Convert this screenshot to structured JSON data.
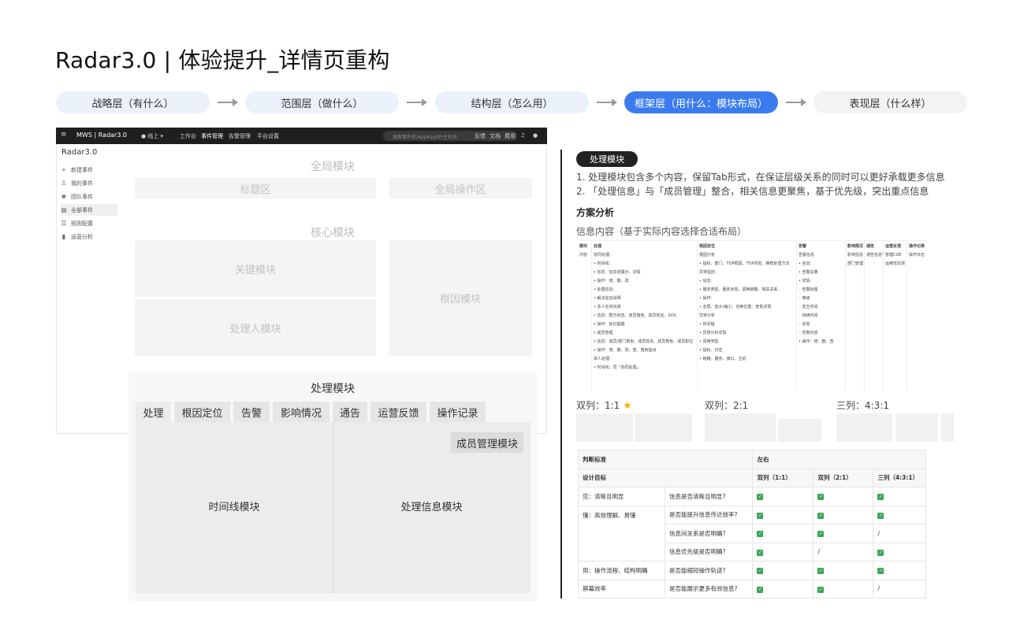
{
  "title": "Radar3.0 | 体验提升_详情页重构",
  "steps": [
    "战略层（有什么）",
    "范围层（做什么）",
    "结构层（怎么用）",
    "框架层（用什么：模块布局）",
    "表现层（什么样）"
  ],
  "appbar": {
    "logo": "MWS | Radar3.0",
    "env": "● 线上 ▾",
    "nav": [
      "工作台",
      "事件管理",
      "告警管理",
      "平台设置"
    ],
    "search_placeholder": "搜索事件名/AppKey/IP/主机名",
    "right": [
      "反馈",
      "文档",
      "费用"
    ]
  },
  "sidebar": {
    "title": "Radar3.0",
    "items": [
      {
        "icon": "+",
        "label": "新建事件"
      },
      {
        "icon": "♙",
        "label": "我的事件"
      },
      {
        "icon": "♚",
        "label": "团队事件"
      },
      {
        "icon": "▤",
        "label": "全部事件"
      },
      {
        "icon": "☰",
        "label": "规则配置"
      },
      {
        "icon": "▮",
        "label": "运营分析"
      }
    ]
  },
  "wire": {
    "global": "全局模块",
    "title_area": "标题区",
    "global_ops": "全局操作区",
    "core": "核心模块",
    "key": "关键模块",
    "handler": "处理人模块",
    "root": "根因模块",
    "process": "处理模块",
    "tabs": [
      "处理",
      "根因定位",
      "告警",
      "影响情况",
      "通告",
      "运营反馈",
      "操作记录"
    ],
    "member": "成员管理模块",
    "timeline": "时间线模块",
    "info": "处理信息模块"
  },
  "right": {
    "pill": "处理模块",
    "notes": [
      "1. 处理模块包含多个内容，保留Tab形式，在保证层级关系的同时可以更好承载更多信息",
      "2. 「处理信息」与「成员管理」整合，相关信息更聚焦，基于优先级，突出重点信息"
    ],
    "analysis": "方案分析",
    "info_content": "信息内容（基于实际内容选择合适布局）",
    "mini_table": {
      "headers": [
        "模块",
        "处理",
        "根因定位",
        "告警",
        "影响情况",
        "通告",
        "运营反馈",
        "操作记录"
      ],
      "col0": [
        "内容"
      ],
      "col1": [
        "协同处理：",
        "• 时间线：",
        "  • 信息：信息流展示、详情",
        "  • 操作：增、删、改",
        "• 处理信息：",
        "  • 解决信息说明",
        "  • 多人在线沟通",
        "    • 信息：群方状态、成员角色、成员姓名、SOS",
        "    • 操作：标记提醒",
        "  • 成员管理",
        "    • 信息：成员/部门角色、成员姓名、成员角色、成员职位",
        "    • 操作：增、删、改、查、角色指派",
        "单人处理：",
        "• 时间线：同「协同处理」"
      ],
      "col2": [
        "根因分析",
        "• 指标、部门、TOP根因、TOP风险、推荐处理方法",
        "异常监控：",
        "  • 信息：",
        "    • 服务类型、服务状态、调用链路、相关关系",
        "  • 操作：",
        "    • 全屏、放大/缩小、切换位置、查看详情",
        "异常分析",
        "  • 时间轴",
        "  • 异常分析详情",
        "    • 调用类型",
        "    • 指标、日志",
        "    • 链路：服务、接口、主机"
      ],
      "col3": [
        "告警信息",
        "• 信息：",
        "  • 告警总量",
        "  • 详情：",
        "    ◦ 告警标题",
        "    ◦ 等级",
        "    ◦ 发生时间",
        "    ◦ 持续时间",
        "    ◦ 状态",
        "    ◦ 告警内容",
        "• 操作：增、删、查"
      ],
      "col4": [
        "影响信息",
        "部门管理"
      ],
      "col5": [
        "通告信息管理"
      ],
      "col6": [
        "管理COE",
        "运维性反馈"
      ],
      "col7": [
        "操作日志"
      ]
    },
    "layouts": [
      {
        "label": "双列：1:1",
        "star": "★"
      },
      {
        "label": "双列：2:1"
      },
      {
        "label": "三列：4:3:1"
      }
    ],
    "compare": {
      "head1": [
        "判断标准",
        "左右"
      ],
      "head2": [
        "设计目标",
        "双列（1:1）",
        "双列（2:1）",
        "三列（4:3:1）"
      ],
      "rows": [
        {
          "goal": "见：清晰且明显",
          "q": "信息是否清晰且明显?",
          "v": [
            "✓",
            "✓",
            "✓"
          ]
        },
        {
          "goal": "懂：高效理解、易懂",
          "q": "是否能提升信息传达效率?",
          "v": [
            "✓",
            "✓",
            "✓"
          ]
        },
        {
          "goal": "",
          "q": "信息间关系是否明确?",
          "v": [
            "✓",
            "✓",
            "/"
          ]
        },
        {
          "goal": "",
          "q": "信息优先级是否明确?",
          "v": [
            "✓",
            "/",
            "✓"
          ]
        },
        {
          "goal": "用：操作流程、结构明确",
          "q": "是否能缩短操作轨迹?",
          "v": [
            "✓",
            "✓",
            "✓"
          ]
        },
        {
          "goal": "屏幕效率",
          "q": "是否能展示更多有效信息?",
          "v": [
            "✓",
            "✓",
            "/"
          ]
        }
      ]
    }
  }
}
